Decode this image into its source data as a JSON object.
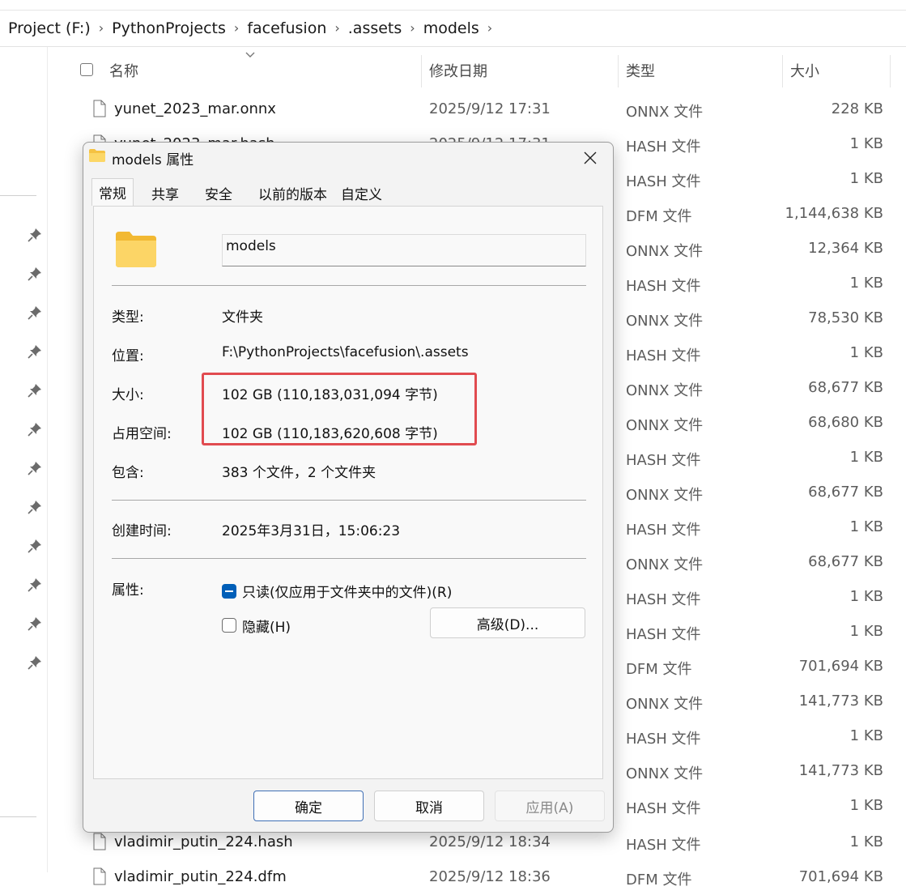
{
  "breadcrumb": [
    "Project (F:)",
    "PythonProjects",
    "facefusion",
    ".assets",
    "models"
  ],
  "columns": {
    "name": "名称",
    "date": "修改日期",
    "type": "类型",
    "size": "大小"
  },
  "rows": [
    {
      "name": "yunet_2023_mar.onnx",
      "date": "2025/9/12 17:31",
      "type": "ONNX 文件",
      "size": "228 KB"
    },
    {
      "name": "yunet_2023_mar.hash",
      "date": "2025/9/12 17:31",
      "type": "HASH 文件",
      "size": "1 KB"
    },
    {
      "name": "",
      "date": "",
      "type": "HASH 文件",
      "size": "1 KB"
    },
    {
      "name": "",
      "date": "",
      "type": "DFM 文件",
      "size": "1,144,638 KB"
    },
    {
      "name": "",
      "date": "",
      "type": "ONNX 文件",
      "size": "12,364 KB"
    },
    {
      "name": "",
      "date": "",
      "type": "HASH 文件",
      "size": "1 KB"
    },
    {
      "name": "",
      "date": "",
      "type": "ONNX 文件",
      "size": "78,530 KB"
    },
    {
      "name": "",
      "date": "",
      "type": "HASH 文件",
      "size": "1 KB"
    },
    {
      "name": "",
      "date": "",
      "type": "ONNX 文件",
      "size": "68,677 KB"
    },
    {
      "name": "",
      "date": "",
      "type": "ONNX 文件",
      "size": "68,680 KB"
    },
    {
      "name": "",
      "date": "",
      "type": "HASH 文件",
      "size": "1 KB"
    },
    {
      "name": "",
      "date": "",
      "type": "ONNX 文件",
      "size": "68,677 KB"
    },
    {
      "name": "",
      "date": "",
      "type": "HASH 文件",
      "size": "1 KB"
    },
    {
      "name": "",
      "date": "",
      "type": "ONNX 文件",
      "size": "68,677 KB"
    },
    {
      "name": "",
      "date": "",
      "type": "HASH 文件",
      "size": "1 KB"
    },
    {
      "name": "",
      "date": "",
      "type": "HASH 文件",
      "size": "1 KB"
    },
    {
      "name": "",
      "date": "",
      "type": "DFM 文件",
      "size": "701,694 KB"
    },
    {
      "name": "",
      "date": "",
      "type": "ONNX 文件",
      "size": "141,773 KB"
    },
    {
      "name": "",
      "date": "",
      "type": "HASH 文件",
      "size": "1 KB"
    },
    {
      "name": "",
      "date": "",
      "type": "ONNX 文件",
      "size": "141,773 KB"
    },
    {
      "name": "",
      "date": "",
      "type": "HASH 文件",
      "size": "1 KB"
    },
    {
      "name": "vladimir_putin_224.hash",
      "date": "2025/9/12 18:34",
      "type": "HASH 文件",
      "size": "1 KB"
    },
    {
      "name": "vladimir_putin_224.dfm",
      "date": "2025/9/12 18:36",
      "type": "DFM 文件",
      "size": "701,694 KB"
    }
  ],
  "dialog": {
    "title": "models 属性",
    "tabs": [
      "常规",
      "共享",
      "安全",
      "以前的版本",
      "自定义"
    ],
    "folder_name": "models",
    "type_label": "类型:",
    "type_value": "文件夹",
    "location_label": "位置:",
    "location_value": "F:\\PythonProjects\\facefusion\\.assets",
    "size_label": "大小:",
    "size_value": "102 GB (110,183,031,094 字节)",
    "size_on_disk_label": "占用空间:",
    "size_on_disk_value": "102 GB (110,183,620,608 字节)",
    "contains_label": "包含:",
    "contains_value": "383 个文件，2 个文件夹",
    "created_label": "创建时间:",
    "created_value": "2025年3月31日，15:06:23",
    "attributes_label": "属性:",
    "readonly_label": "只读(仅应用于文件夹中的文件)(R)",
    "hidden_label": "隐藏(H)",
    "advanced_button": "高级(D)...",
    "ok_button": "确定",
    "cancel_button": "取消",
    "apply_button": "应用(A)",
    "highlight_color": "#e14b50"
  }
}
